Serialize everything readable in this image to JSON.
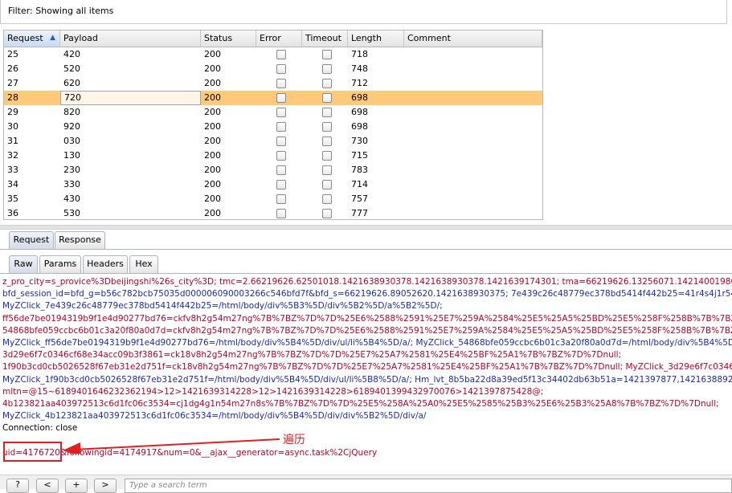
{
  "filter": {
    "label": "Filter:  Showing all items"
  },
  "table": {
    "columns": [
      "Request",
      "Payload",
      "Status",
      "Error",
      "Timeout",
      "Length",
      "Comment"
    ],
    "sort_indicator": "▲",
    "rows": [
      {
        "request": "25",
        "payload": "420",
        "status": "200",
        "length": "718"
      },
      {
        "request": "26",
        "payload": "520",
        "status": "200",
        "length": "748"
      },
      {
        "request": "27",
        "payload": "620",
        "status": "200",
        "length": "712"
      },
      {
        "request": "28",
        "payload": "720",
        "status": "200",
        "length": "698"
      },
      {
        "request": "29",
        "payload": "820",
        "status": "200",
        "length": "698"
      },
      {
        "request": "30",
        "payload": "920",
        "status": "200",
        "length": "698"
      },
      {
        "request": "31",
        "payload": "030",
        "status": "200",
        "length": "730"
      },
      {
        "request": "32",
        "payload": "130",
        "status": "200",
        "length": "715"
      },
      {
        "request": "33",
        "payload": "230",
        "status": "200",
        "length": "783"
      },
      {
        "request": "34",
        "payload": "330",
        "status": "200",
        "length": "714"
      },
      {
        "request": "35",
        "payload": "430",
        "status": "200",
        "length": "757"
      },
      {
        "request": "36",
        "payload": "530",
        "status": "200",
        "length": "777"
      }
    ],
    "selected_row": 3,
    "selected_color": "#ffc97a"
  },
  "tabs_top": [
    "Request",
    "Response"
  ],
  "tabs_sub": [
    "Raw",
    "Params",
    "Headers",
    "Hex"
  ],
  "message_lines": [
    "z_pro_city=s_provice%3Dbeijingshi%26s_city%3D; tmc=2.66219626.62501018.1421638930378.1421638930378.1421639174301; tma=66219626.13256071.1421400198023.14214001",
    "bfd_session_id=bfd_g=b56c782bcb75035d000006090003266c546bfd7f&bfd_s=66219626.89052620.1421638930375; 7e439c26c48779ec378bd5414f442b25=41r4s4j1r54m27ng%7",
    "MyZClick_7e439c26c48779ec378bd5414f442b25=/html/body/div%5B3%5D/div%5B2%5D/a%5B2%5D/;",
    "ff56de7be0194319b9f1e4d90277bd76=ckfv8h2g54m27ng%7B%7BZ%7D%7D%25E6%2588%2591%25E7%259A%2584%25E5%25A5%25BD%25E5%258F%258B%7B%7BZ%7D%7",
    "54868bfe059ccbc6b01c3a20f80a0d7d=ckfv8h2g54m27ng%7B%7BZ%7D%7D%25E6%2588%2591%25E7%259A%2584%25E5%25A5%25BD%25E5%258F%258B%7B%7BZ%7D%7",
    "MyZClick_ff56de7be0194319b9f1e4d90277bd76=/html/body/div%5B4%5D/div/ul/li%5B4%5D/a/; MyZClick_54868bfe059ccbc6b01c3a20f80a0d7d=/html/body/div%5B4%5D/",
    "3d29e6f7c0346cf68e34acc09b3f3861=ck18v8h2g54m27ng%7B%7BZ%7D%7D%25E7%25A7%2581%25E4%25BF%25A1%7B%7BZ%7D%7Dnull;",
    "1f90b3cd0cb5026528f67eb31e2d751f=ck18v8h2g54m27ng%7B%7BZ%7D%7D%25E7%25A7%2581%25E4%25BF%25A1%7B%7BZ%7D%7Dnull; MyZClick_3d29e6f7c0346cf68e34",
    "MyZClick_1f90b3cd0cb5026528f67eb31e2d751f=/html/body/div%5B4%5D/div/ul/li%5B8%5D/a/; Hm_lvt_8b5ba22d8a39ed5f13c34402db63b51a=1421397877,1421638892; Hm_",
    "mltn=@15~6189401646232362194>12>1421639314228>12>1421639314228>6189401399432970076>1421397875428@;",
    "4b123821aa403972513c6d1fc06c3534=cj1dg4g1n54m27n8s%7B%7BZ%7D%7D%25E5%258A%25A0%25E5%2585%25B3%25E6%25B3%25A8%7B%7BZ%7D%7Dnull;",
    "MyZClick_4b123821aa403972513c6d1fc06c3534=/html/body/div%5B4%5D/div/div%5B2%5D/div/a/",
    "Connection: close",
    "",
    "uid=4176720&followingid=4174917&num=0&__ajax__generator=async.task%2CjQuery"
  ],
  "annotation": "遍历",
  "nav_buttons": [
    "?",
    "<",
    "+",
    ">"
  ],
  "search_placeholder": "Type a search term",
  "accent_red": "#e02020"
}
